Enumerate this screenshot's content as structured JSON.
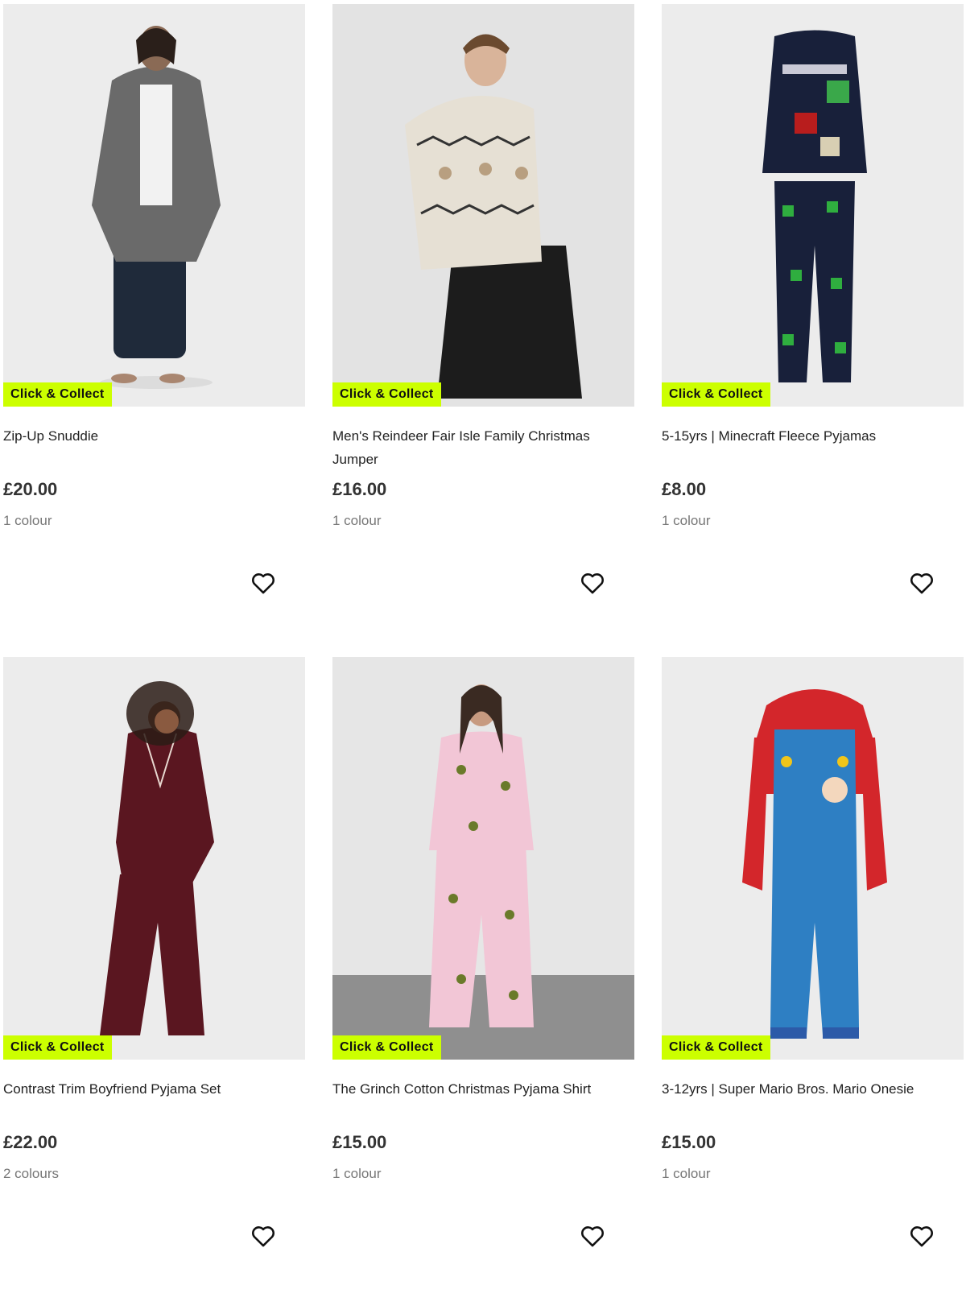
{
  "products": [
    {
      "badge": "Click & Collect",
      "title": "Zip-Up Snuddie",
      "price": "£20.00",
      "colours": "1 colour",
      "image": "grey-hooded-snuddie-photo"
    },
    {
      "badge": "Click & Collect",
      "title": "Men's Reindeer Fair Isle Family Christmas Jumper",
      "price": "£16.00",
      "colours": "1 colour",
      "image": "reindeer-jumper-photo"
    },
    {
      "badge": "Click & Collect",
      "title": "5-15yrs | Minecraft Fleece Pyjamas",
      "price": "£8.00",
      "colours": "1 colour",
      "image": "minecraft-pyjamas-photo"
    },
    {
      "badge": "Click & Collect",
      "title": "Contrast Trim Boyfriend Pyjama Set",
      "price": "£22.00",
      "colours": "2 colours",
      "image": "burgundy-pyjama-set-photo"
    },
    {
      "badge": "Click & Collect",
      "title": "The Grinch Cotton Christmas Pyjama Shirt",
      "price": "£15.00",
      "colours": "1 colour",
      "image": "grinch-pyjamas-photo"
    },
    {
      "badge": "Click & Collect",
      "title": "3-12yrs | Super Mario Bros. Mario Onesie",
      "price": "£15.00",
      "colours": "1 colour",
      "image": "mario-onesie-photo"
    }
  ],
  "colors": {
    "badge_bg": "#ccff00",
    "image_bg": "#ebebeb",
    "price": "#333333",
    "muted": "#777777"
  },
  "icons": {
    "favourite": "heart-outline-icon"
  }
}
